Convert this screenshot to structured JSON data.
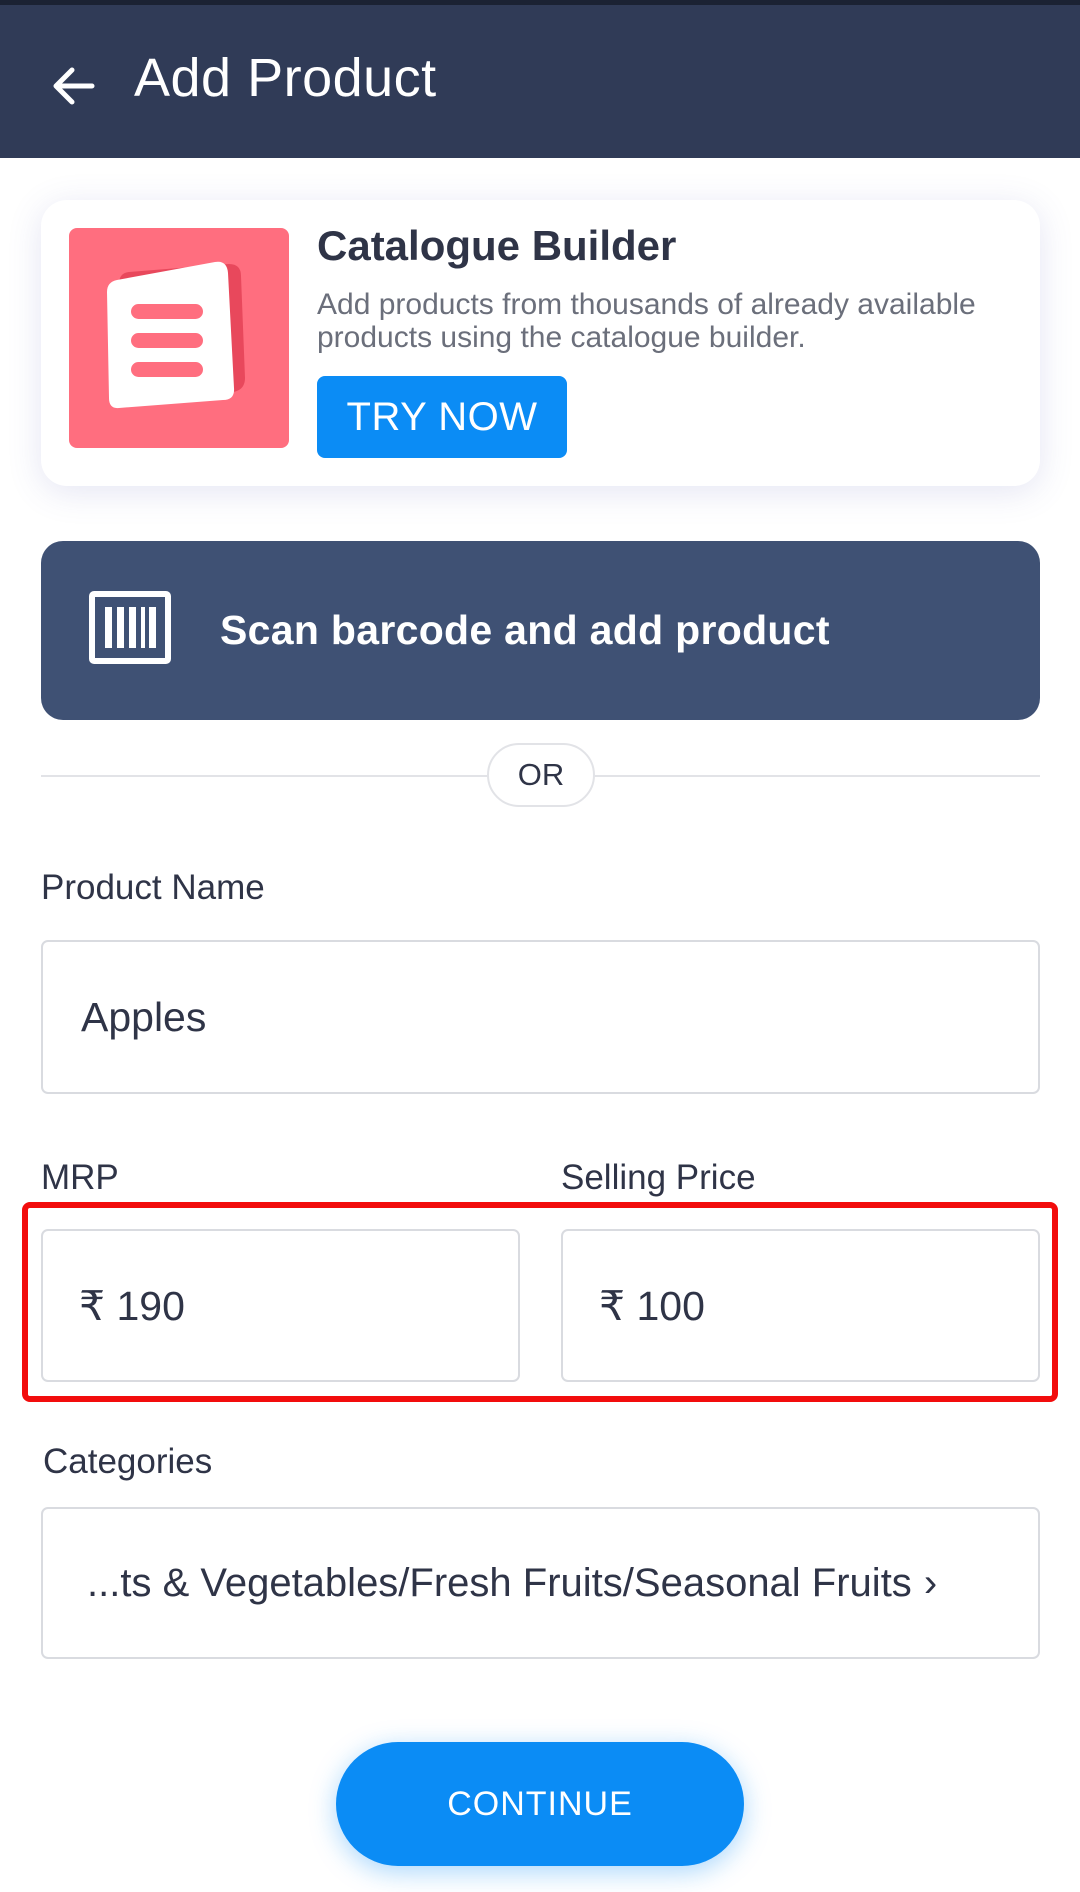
{
  "header": {
    "title": "Add Product",
    "back_icon": "arrow-left-icon"
  },
  "catalogue_builder": {
    "title": "Catalogue Builder",
    "description": "Add products from thousands of already available products using the catalogue builder.",
    "try_now_label": "TRY NOW",
    "thumb_icon": "catalogue-book-icon"
  },
  "scan": {
    "label": "Scan barcode and add product",
    "icon": "barcode-icon"
  },
  "divider": {
    "or_label": "OR"
  },
  "form": {
    "product_name": {
      "label": "Product Name",
      "value": "Apples"
    },
    "mrp": {
      "label": "MRP",
      "value": "₹ 190"
    },
    "selling_price": {
      "label": "Selling Price",
      "value": "₹ 100"
    },
    "categories": {
      "label": "Categories",
      "value": "...ts & Vegetables/Fresh Fruits/Seasonal Fruits",
      "chevron": "›"
    }
  },
  "continue_label": "CONTINUE",
  "colors": {
    "header_bg": "#303b57",
    "accent_blue": "#0b8cf5",
    "scan_bg": "#3f5174",
    "catalogue_thumb": "#ff6e7f",
    "highlight_red": "#f20d0d"
  }
}
